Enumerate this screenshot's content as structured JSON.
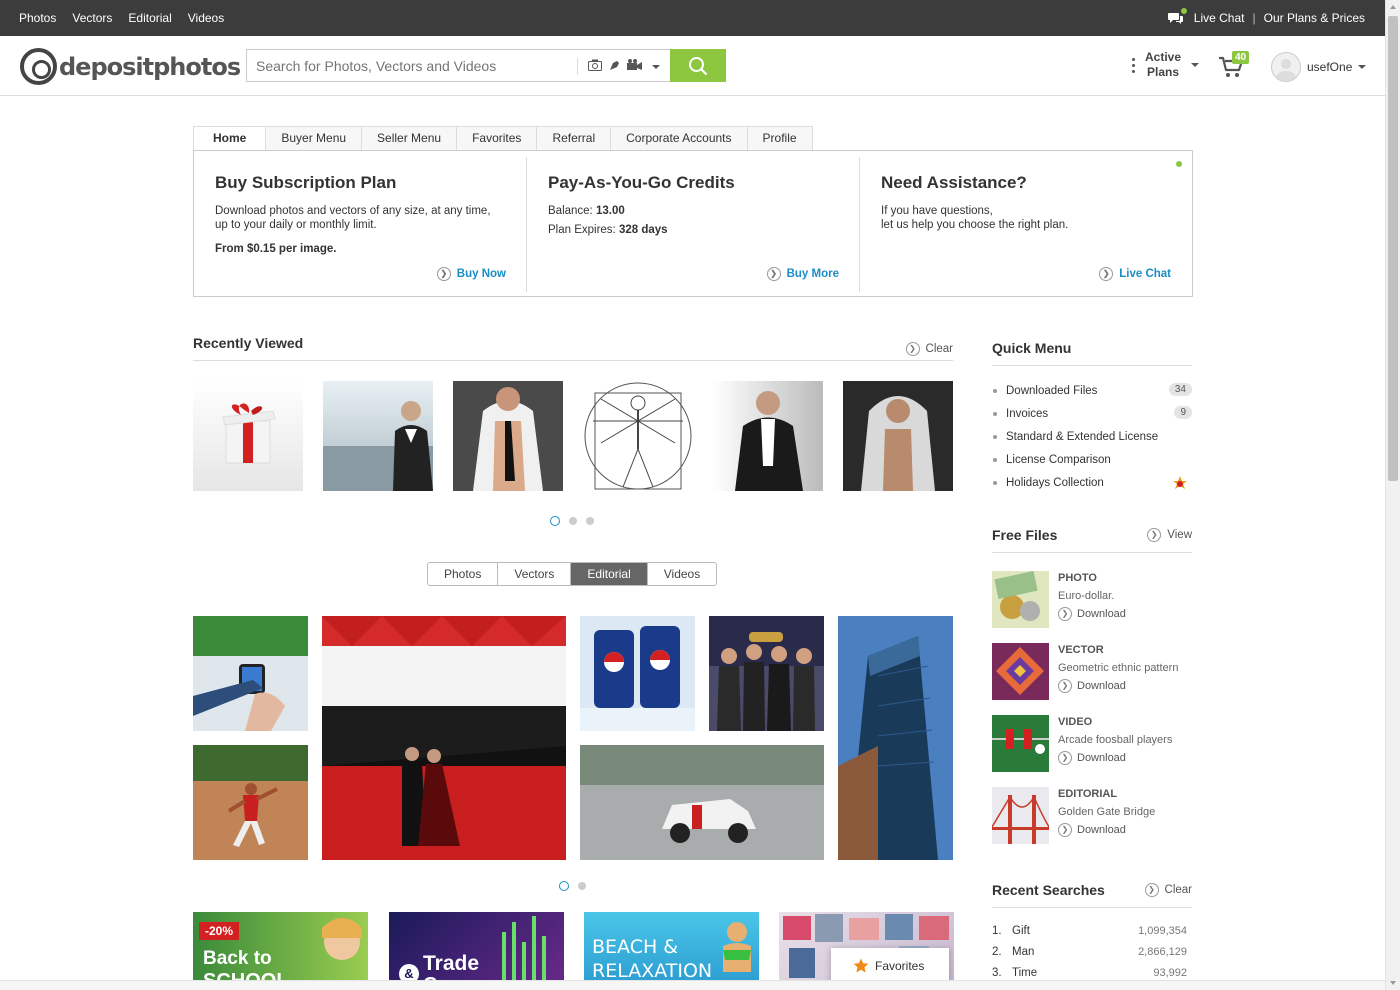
{
  "topbar": {
    "nav": [
      "Photos",
      "Vectors",
      "Editorial",
      "Videos"
    ],
    "live_chat": "Live Chat",
    "separator": "|",
    "plans_prices": "Our Plans & Prices"
  },
  "header": {
    "logo_text": "depositphotos",
    "search_placeholder": "Search for Photos, Vectors and Videos",
    "active_plans_line1": "Active",
    "active_plans_line2": "Plans",
    "cart_count": "40",
    "username": "usefOne"
  },
  "tabs": [
    "Home",
    "Buyer Menu",
    "Seller Menu",
    "Favorites",
    "Referral",
    "Corporate Accounts",
    "Profile"
  ],
  "panel": {
    "subscription": {
      "title": "Buy Subscription Plan",
      "text": "Download photos and vectors of any size, at any time, up to your daily or monthly limit.",
      "price": "From $0.15 per image.",
      "action": "Buy Now"
    },
    "credits": {
      "title": "Pay-As-You-Go Credits",
      "balance_label": "Balance:",
      "balance_value": "13.00",
      "expires_label": "Plan Expires:",
      "expires_value": "328 days",
      "action": "Buy More"
    },
    "assistance": {
      "title": "Need Assistance?",
      "line1": "If you have questions,",
      "line2": "let us help you choose the right plan.",
      "action": "Live Chat"
    }
  },
  "recently_viewed": {
    "title": "Recently Viewed",
    "clear": "Clear"
  },
  "media_types": [
    "Photos",
    "Vectors",
    "Editorial",
    "Videos"
  ],
  "media_types_selected": "Editorial",
  "banners": {
    "b1_badge": "-20%",
    "b1_text": "Back to",
    "b1_text2": "SCHOOL",
    "b2_text": "Trade",
    "b2_text2": "Commerce",
    "b2_amp": "&",
    "b3_text": "BEACH &",
    "b3_text2": "RELAXATION"
  },
  "favorites_popup": "Favorites",
  "quick_menu": {
    "title": "Quick Menu",
    "items": [
      {
        "label": "Downloaded Files",
        "badge": "34"
      },
      {
        "label": "Invoices",
        "badge": "9"
      },
      {
        "label": "Standard & Extended License",
        "badge": ""
      },
      {
        "label": "License Comparison",
        "badge": ""
      },
      {
        "label": "Holidays Collection",
        "badge": ""
      }
    ]
  },
  "free_files": {
    "title": "Free Files",
    "view": "View",
    "download": "Download",
    "items": [
      {
        "type": "PHOTO",
        "desc": "Euro-dollar."
      },
      {
        "type": "VECTOR",
        "desc": "Geometric ethnic pattern"
      },
      {
        "type": "VIDEO",
        "desc": "Arcade foosball players"
      },
      {
        "type": "EDITORIAL",
        "desc": "Golden Gate Bridge"
      }
    ]
  },
  "recent_searches": {
    "title": "Recent Searches",
    "clear": "Clear",
    "items": [
      {
        "num": "1.",
        "term": "Gift",
        "count": "1,099,354"
      },
      {
        "num": "2.",
        "term": "Man",
        "count": "2,866,129"
      },
      {
        "num": "3.",
        "term": "Time",
        "count": "93,992"
      }
    ]
  },
  "colors": {
    "accent_green": "#8dc63f",
    "link_blue": "#1a8dc6",
    "topbar_bg": "#3c3c3c"
  }
}
